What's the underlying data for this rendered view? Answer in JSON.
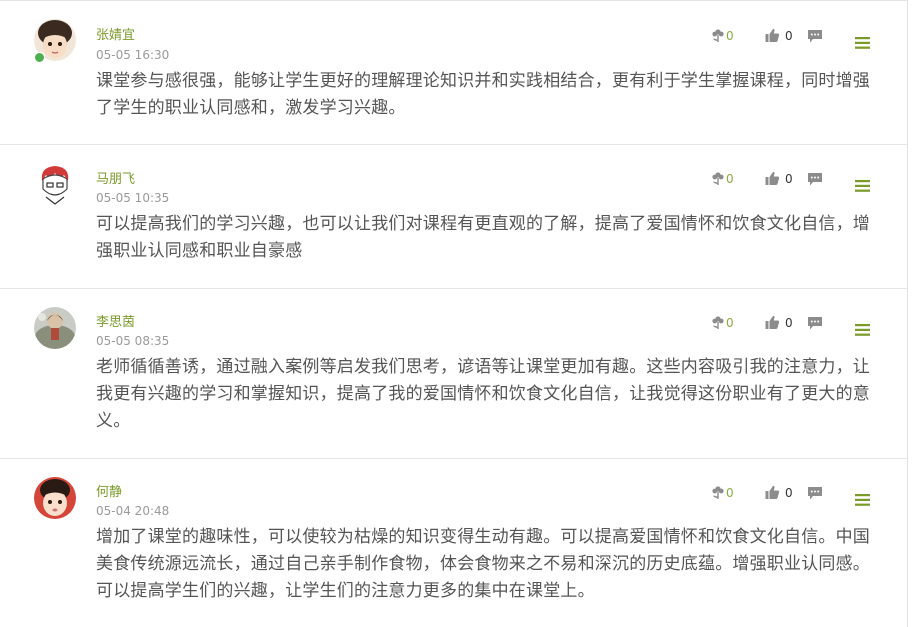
{
  "comments": [
    {
      "author": "张婧宜",
      "time": "05-05 16:30",
      "text": "课堂参与感很强，能够让学生更好的理解理论知识并和实践相结合，更有利于学生掌握课程，同时增强了学生的职业认同感和，激发学习兴趣。",
      "flowers": "0",
      "likes": "0"
    },
    {
      "author": "马朋飞",
      "time": "05-05 10:35",
      "text": "可以提高我们的学习兴趣，也可以让我们对课程有更直观的了解，提高了爱国情怀和饮食文化自信，增强职业认同感和职业自豪感",
      "flowers": "0",
      "likes": "0"
    },
    {
      "author": "李思茵",
      "time": "05-05 08:35",
      "text": "老师循循善诱，通过融入案例等启发我们思考，谚语等让课堂更加有趣。这些内容吸引我的注意力，让我更有兴趣的学习和掌握知识，提高了我的爱国情怀和饮食文化自信，让我觉得这份职业有了更大的意义。",
      "flowers": "0",
      "likes": "0"
    },
    {
      "author": "何静",
      "time": "05-04 20:48",
      "text": "增加了课堂的趣味性，可以使较为枯燥的知识变得生动有趣。可以提高爱国情怀和饮食文化自信。中国美食传统源远流长，通过自己亲手制作食物，体会食物来之不易和深沉的历史底蕴。增强职业认同感。可以提高学生们的兴趣，让学生们的注意力更多的集中在课堂上。",
      "flowers": "0",
      "likes": "0"
    }
  ],
  "icons": {
    "flower": "flower-icon",
    "like": "thumbs-up-icon",
    "reply": "comment-bubble-icon",
    "menu": "hamburger-menu-icon"
  },
  "colors": {
    "name": "#7a9a2a",
    "menu": "#7a9a2a",
    "text": "#555555",
    "time": "#9a9a9a",
    "icon": "#8c8c8c"
  }
}
